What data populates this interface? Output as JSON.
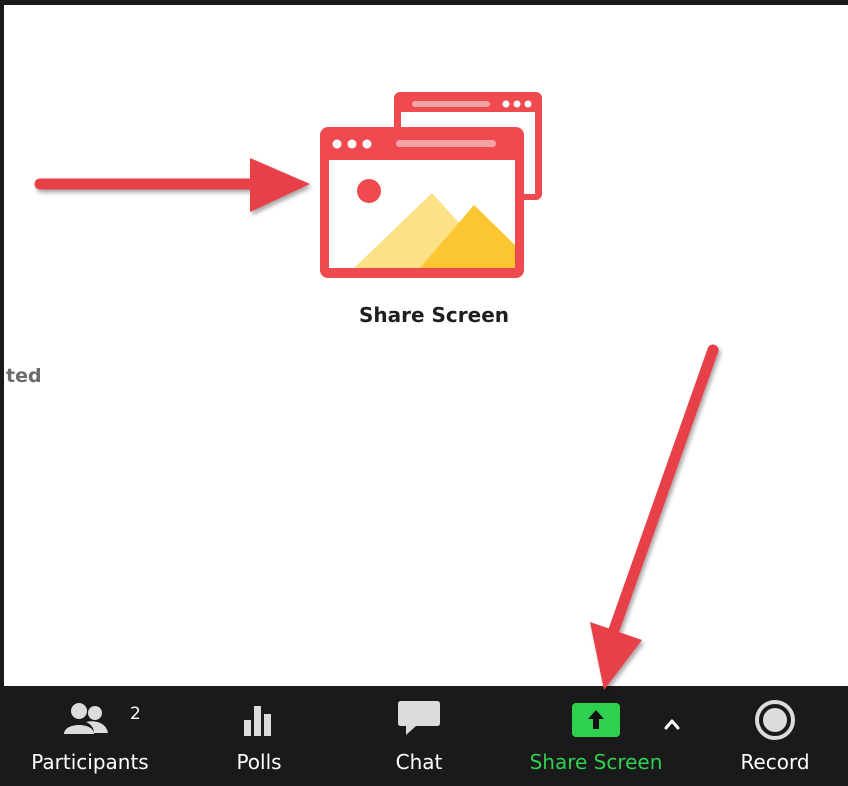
{
  "main": {
    "share_title": "Share Screen",
    "side_fragment": "ted"
  },
  "toolbar": {
    "participants": {
      "label": "Participants",
      "count": "2",
      "icon": "participants-icon"
    },
    "polls": {
      "label": "Polls",
      "icon": "polls-icon"
    },
    "chat": {
      "label": "Chat",
      "icon": "chat-icon"
    },
    "share_screen": {
      "label": "Share Screen",
      "icon": "share-screen-up-arrow-icon",
      "active": true
    },
    "share_options": {
      "icon": "caret-up-icon"
    },
    "record": {
      "label": "Record",
      "icon": "record-icon"
    }
  },
  "colors": {
    "accent_red": "#ef4a4f",
    "annotation_arrow": "#e8404a",
    "toolbar_bg": "#1a1a1a",
    "share_green": "#2fd050",
    "mountain_light": "#fce186",
    "mountain_dark": "#fbc630"
  }
}
